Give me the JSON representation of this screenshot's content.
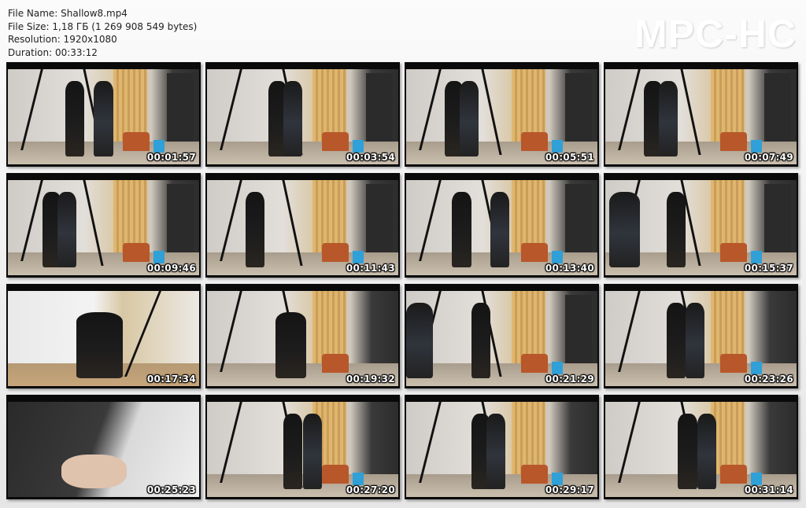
{
  "info": {
    "file_name": "File Name: Shallow8.mp4",
    "file_size": "File Size: 1,18 ГБ (1 269 908 549 bytes)",
    "resolution": "Resolution: 1920x1080",
    "duration": "Duration: 00:33:12"
  },
  "logo": "MPC-HC",
  "thumbnails": [
    {
      "time": "00:01:57"
    },
    {
      "time": "00:03:54"
    },
    {
      "time": "00:05:51"
    },
    {
      "time": "00:07:49"
    },
    {
      "time": "00:09:46"
    },
    {
      "time": "00:11:43"
    },
    {
      "time": "00:13:40"
    },
    {
      "time": "00:15:37"
    },
    {
      "time": "00:17:34"
    },
    {
      "time": "00:19:32"
    },
    {
      "time": "00:21:29"
    },
    {
      "time": "00:23:26"
    },
    {
      "time": "00:25:23"
    },
    {
      "time": "00:27:20"
    },
    {
      "time": "00:29:17"
    },
    {
      "time": "00:31:14"
    }
  ]
}
